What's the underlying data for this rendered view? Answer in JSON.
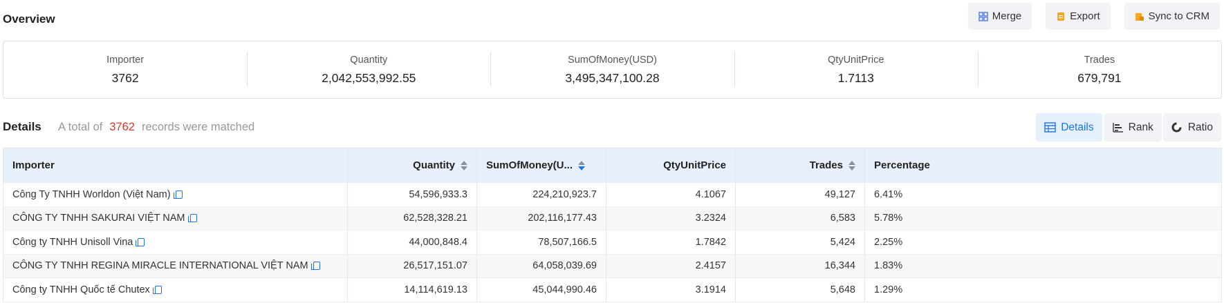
{
  "header": {
    "title": "Overview",
    "actions": [
      {
        "label": "Merge",
        "icon": "merge-icon",
        "color": "#4a7be8"
      },
      {
        "label": "Export",
        "icon": "export-icon",
        "color": "#f5a623"
      },
      {
        "label": "Sync to CRM",
        "icon": "sync-crm-icon",
        "color": "#f5a623"
      }
    ]
  },
  "overview": [
    {
      "label": "Importer",
      "value": "3762"
    },
    {
      "label": "Quantity",
      "value": "2,042,553,992.55"
    },
    {
      "label": "SumOfMoney(USD)",
      "value": "3,495,347,100.28"
    },
    {
      "label": "QtyUnitPrice",
      "value": "1.7113"
    },
    {
      "label": "Trades",
      "value": "679,791"
    }
  ],
  "details": {
    "title": "Details",
    "prefix": "A total of",
    "count": "3762",
    "suffix": "records were matched",
    "tabs": [
      {
        "label": "Details",
        "icon": "table-icon",
        "active": true
      },
      {
        "label": "Rank",
        "icon": "bar-chart-icon",
        "active": false
      },
      {
        "label": "Ratio",
        "icon": "pie-chart-icon",
        "active": false
      }
    ]
  },
  "table": {
    "columns": [
      "Importer",
      "Quantity",
      "SumOfMoney(U...",
      "QtyUnitPrice",
      "Trades",
      "Percentage"
    ],
    "rows": [
      [
        "Công Ty TNHH Worldon (Việt Nam)",
        "54,596,933.3",
        "224,210,923.7",
        "4.1067",
        "49,127",
        "6.41%"
      ],
      [
        "CÔNG TY TNHH SAKURAI VIỆT NAM",
        "62,528,328.21",
        "202,116,177.43",
        "3.2324",
        "6,583",
        "5.78%"
      ],
      [
        "Công ty TNHH Unisoll Vina",
        "44,000,848.4",
        "78,507,166.5",
        "1.7842",
        "5,424",
        "2.25%"
      ],
      [
        "CÔNG TY TNHH REGINA MIRACLE INTERNATIONAL VIỆT NAM",
        "26,517,151.07",
        "64,058,039.69",
        "2.4157",
        "16,344",
        "1.83%"
      ],
      [
        "Công ty TNHH Quốc tế Chutex",
        "14,114,619.13",
        "45,044,990.46",
        "3.1914",
        "5,648",
        "1.29%"
      ]
    ]
  }
}
